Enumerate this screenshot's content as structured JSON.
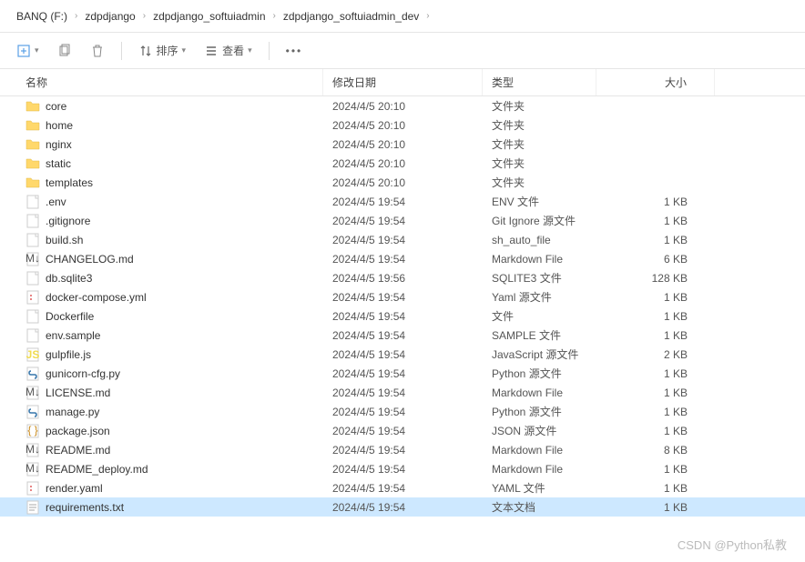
{
  "breadcrumb": [
    "BANQ (F:)",
    "zdpdjango",
    "zdpdjango_softuiadmin",
    "zdpdjango_softuiadmin_dev"
  ],
  "toolbar": {
    "sort": "排序",
    "view": "查看"
  },
  "columns": {
    "name": "名称",
    "date": "修改日期",
    "type": "类型",
    "size": "大小"
  },
  "files": [
    {
      "icon": "folder",
      "name": "core",
      "date": "2024/4/5 20:10",
      "type": "文件夹",
      "size": ""
    },
    {
      "icon": "folder",
      "name": "home",
      "date": "2024/4/5 20:10",
      "type": "文件夹",
      "size": ""
    },
    {
      "icon": "folder",
      "name": "nginx",
      "date": "2024/4/5 20:10",
      "type": "文件夹",
      "size": ""
    },
    {
      "icon": "folder",
      "name": "static",
      "date": "2024/4/5 20:10",
      "type": "文件夹",
      "size": ""
    },
    {
      "icon": "folder",
      "name": "templates",
      "date": "2024/4/5 20:10",
      "type": "文件夹",
      "size": ""
    },
    {
      "icon": "file",
      "name": ".env",
      "date": "2024/4/5 19:54",
      "type": "ENV 文件",
      "size": "1 KB"
    },
    {
      "icon": "file",
      "name": ".gitignore",
      "date": "2024/4/5 19:54",
      "type": "Git Ignore 源文件",
      "size": "1 KB"
    },
    {
      "icon": "file",
      "name": "build.sh",
      "date": "2024/4/5 19:54",
      "type": "sh_auto_file",
      "size": "1 KB"
    },
    {
      "icon": "md",
      "name": "CHANGELOG.md",
      "date": "2024/4/5 19:54",
      "type": "Markdown File",
      "size": "6 KB"
    },
    {
      "icon": "file",
      "name": "db.sqlite3",
      "date": "2024/4/5 19:56",
      "type": "SQLITE3 文件",
      "size": "128 KB"
    },
    {
      "icon": "yaml",
      "name": "docker-compose.yml",
      "date": "2024/4/5 19:54",
      "type": "Yaml 源文件",
      "size": "1 KB"
    },
    {
      "icon": "file",
      "name": "Dockerfile",
      "date": "2024/4/5 19:54",
      "type": "文件",
      "size": "1 KB"
    },
    {
      "icon": "file",
      "name": "env.sample",
      "date": "2024/4/5 19:54",
      "type": "SAMPLE 文件",
      "size": "1 KB"
    },
    {
      "icon": "js",
      "name": "gulpfile.js",
      "date": "2024/4/5 19:54",
      "type": "JavaScript 源文件",
      "size": "2 KB"
    },
    {
      "icon": "py",
      "name": "gunicorn-cfg.py",
      "date": "2024/4/5 19:54",
      "type": "Python 源文件",
      "size": "1 KB"
    },
    {
      "icon": "md",
      "name": "LICENSE.md",
      "date": "2024/4/5 19:54",
      "type": "Markdown File",
      "size": "1 KB"
    },
    {
      "icon": "py",
      "name": "manage.py",
      "date": "2024/4/5 19:54",
      "type": "Python 源文件",
      "size": "1 KB"
    },
    {
      "icon": "json",
      "name": "package.json",
      "date": "2024/4/5 19:54",
      "type": "JSON 源文件",
      "size": "1 KB"
    },
    {
      "icon": "md",
      "name": "README.md",
      "date": "2024/4/5 19:54",
      "type": "Markdown File",
      "size": "8 KB"
    },
    {
      "icon": "md",
      "name": "README_deploy.md",
      "date": "2024/4/5 19:54",
      "type": "Markdown File",
      "size": "1 KB"
    },
    {
      "icon": "yaml",
      "name": "render.yaml",
      "date": "2024/4/5 19:54",
      "type": "YAML 文件",
      "size": "1 KB"
    },
    {
      "icon": "txt",
      "name": "requirements.txt",
      "date": "2024/4/5 19:54",
      "type": "文本文档",
      "size": "1 KB",
      "selected": true
    }
  ],
  "watermark": "CSDN @Python私教"
}
